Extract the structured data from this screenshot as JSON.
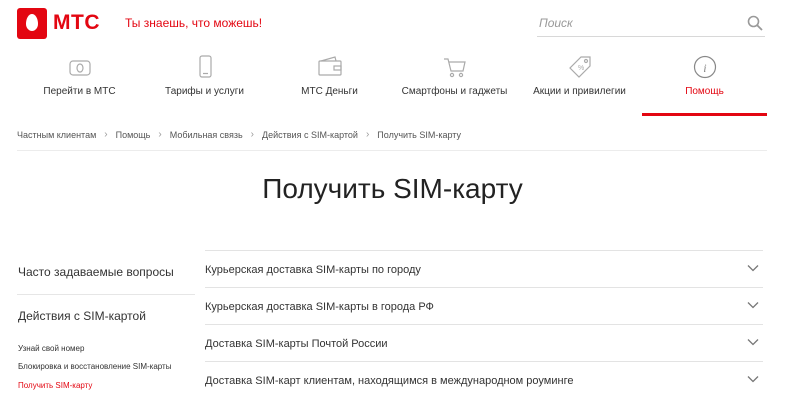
{
  "brand": {
    "logo_text": "МТС",
    "slogan": "Ты знаешь, что можешь!",
    "accent_color": "#e30611"
  },
  "search": {
    "placeholder": "Поиск",
    "icon": "search-icon"
  },
  "nav": {
    "items": [
      {
        "label": "Перейти в МТС",
        "icon": "egg-sim-icon",
        "active": false
      },
      {
        "label": "Тарифы и услуги",
        "icon": "phone-icon",
        "active": false
      },
      {
        "label": "МТС Деньги",
        "icon": "wallet-icon",
        "active": false
      },
      {
        "label": "Смартфоны и гаджеты",
        "icon": "cart-icon",
        "active": false
      },
      {
        "label": "Акции и привилегии",
        "icon": "tag-icon",
        "active": false
      },
      {
        "label": "Помощь",
        "icon": "info-icon",
        "active": true
      }
    ]
  },
  "breadcrumb": [
    "Частным клиентам",
    "Помощь",
    "Мобильная связь",
    "Действия с SIM-картой",
    "Получить SIM-карту"
  ],
  "page_title": "Получить SIM-карту",
  "sidebar": {
    "faq": "Часто задаваемые вопросы",
    "sim_actions": "Действия с SIM-картой",
    "links": [
      {
        "label": "Узнай свой номер",
        "active": false
      },
      {
        "label": "Блокировка и восстановление SIM-карты",
        "active": false
      },
      {
        "label": "Получить SIM-карту",
        "active": true
      }
    ]
  },
  "accordion": [
    {
      "label": "Курьерская доставка SIM-карты по городу"
    },
    {
      "label": "Курьерская доставка SIM-карты в города РФ"
    },
    {
      "label": "Доставка SIM-карты Почтой России"
    },
    {
      "label": "Доставка SIM-карт клиентам, находящимся в международном роуминге"
    }
  ]
}
